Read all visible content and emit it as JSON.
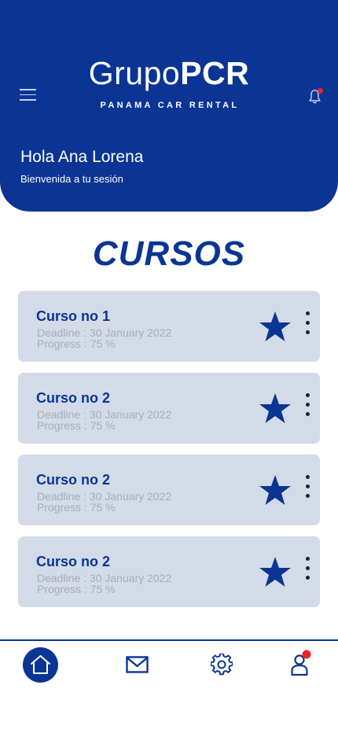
{
  "header": {
    "logo_light": "Grupo",
    "logo_bold": "PCR",
    "logo_tagline": "PANAMA CAR RENTAL",
    "greeting": "Hola Ana Lorena",
    "welcome": "Bienvenida a tu sesión",
    "menu_icon": "hamburger-menu-icon",
    "notification_icon": "bell-icon",
    "has_notification": true
  },
  "section_title": "CURSOS",
  "courses": [
    {
      "title": "Curso no 1",
      "deadline": "Deadline : 30 January 2022",
      "progress": "Progress : 75 %",
      "starred": true
    },
    {
      "title": "Curso no 2",
      "deadline": "Deadline : 30 January 2022",
      "progress": "Progress : 75 %",
      "starred": true
    },
    {
      "title": "Curso no 2",
      "deadline": "Deadline : 30 January 2022",
      "progress": "Progress : 75 %",
      "starred": true
    },
    {
      "title": "Curso no 2",
      "deadline": "Deadline : 30 January 2022",
      "progress": "Progress : 75 %",
      "starred": true
    }
  ],
  "bottom_nav": {
    "items": [
      "home-icon",
      "mail-icon",
      "gear-icon",
      "user-icon"
    ],
    "active": "home-icon",
    "user_has_notification": true
  },
  "colors": {
    "primary": "#0a3594",
    "card_bg": "#d3dbe9",
    "muted_text": "#a7acb4",
    "notification_dot": "#e8232c"
  }
}
